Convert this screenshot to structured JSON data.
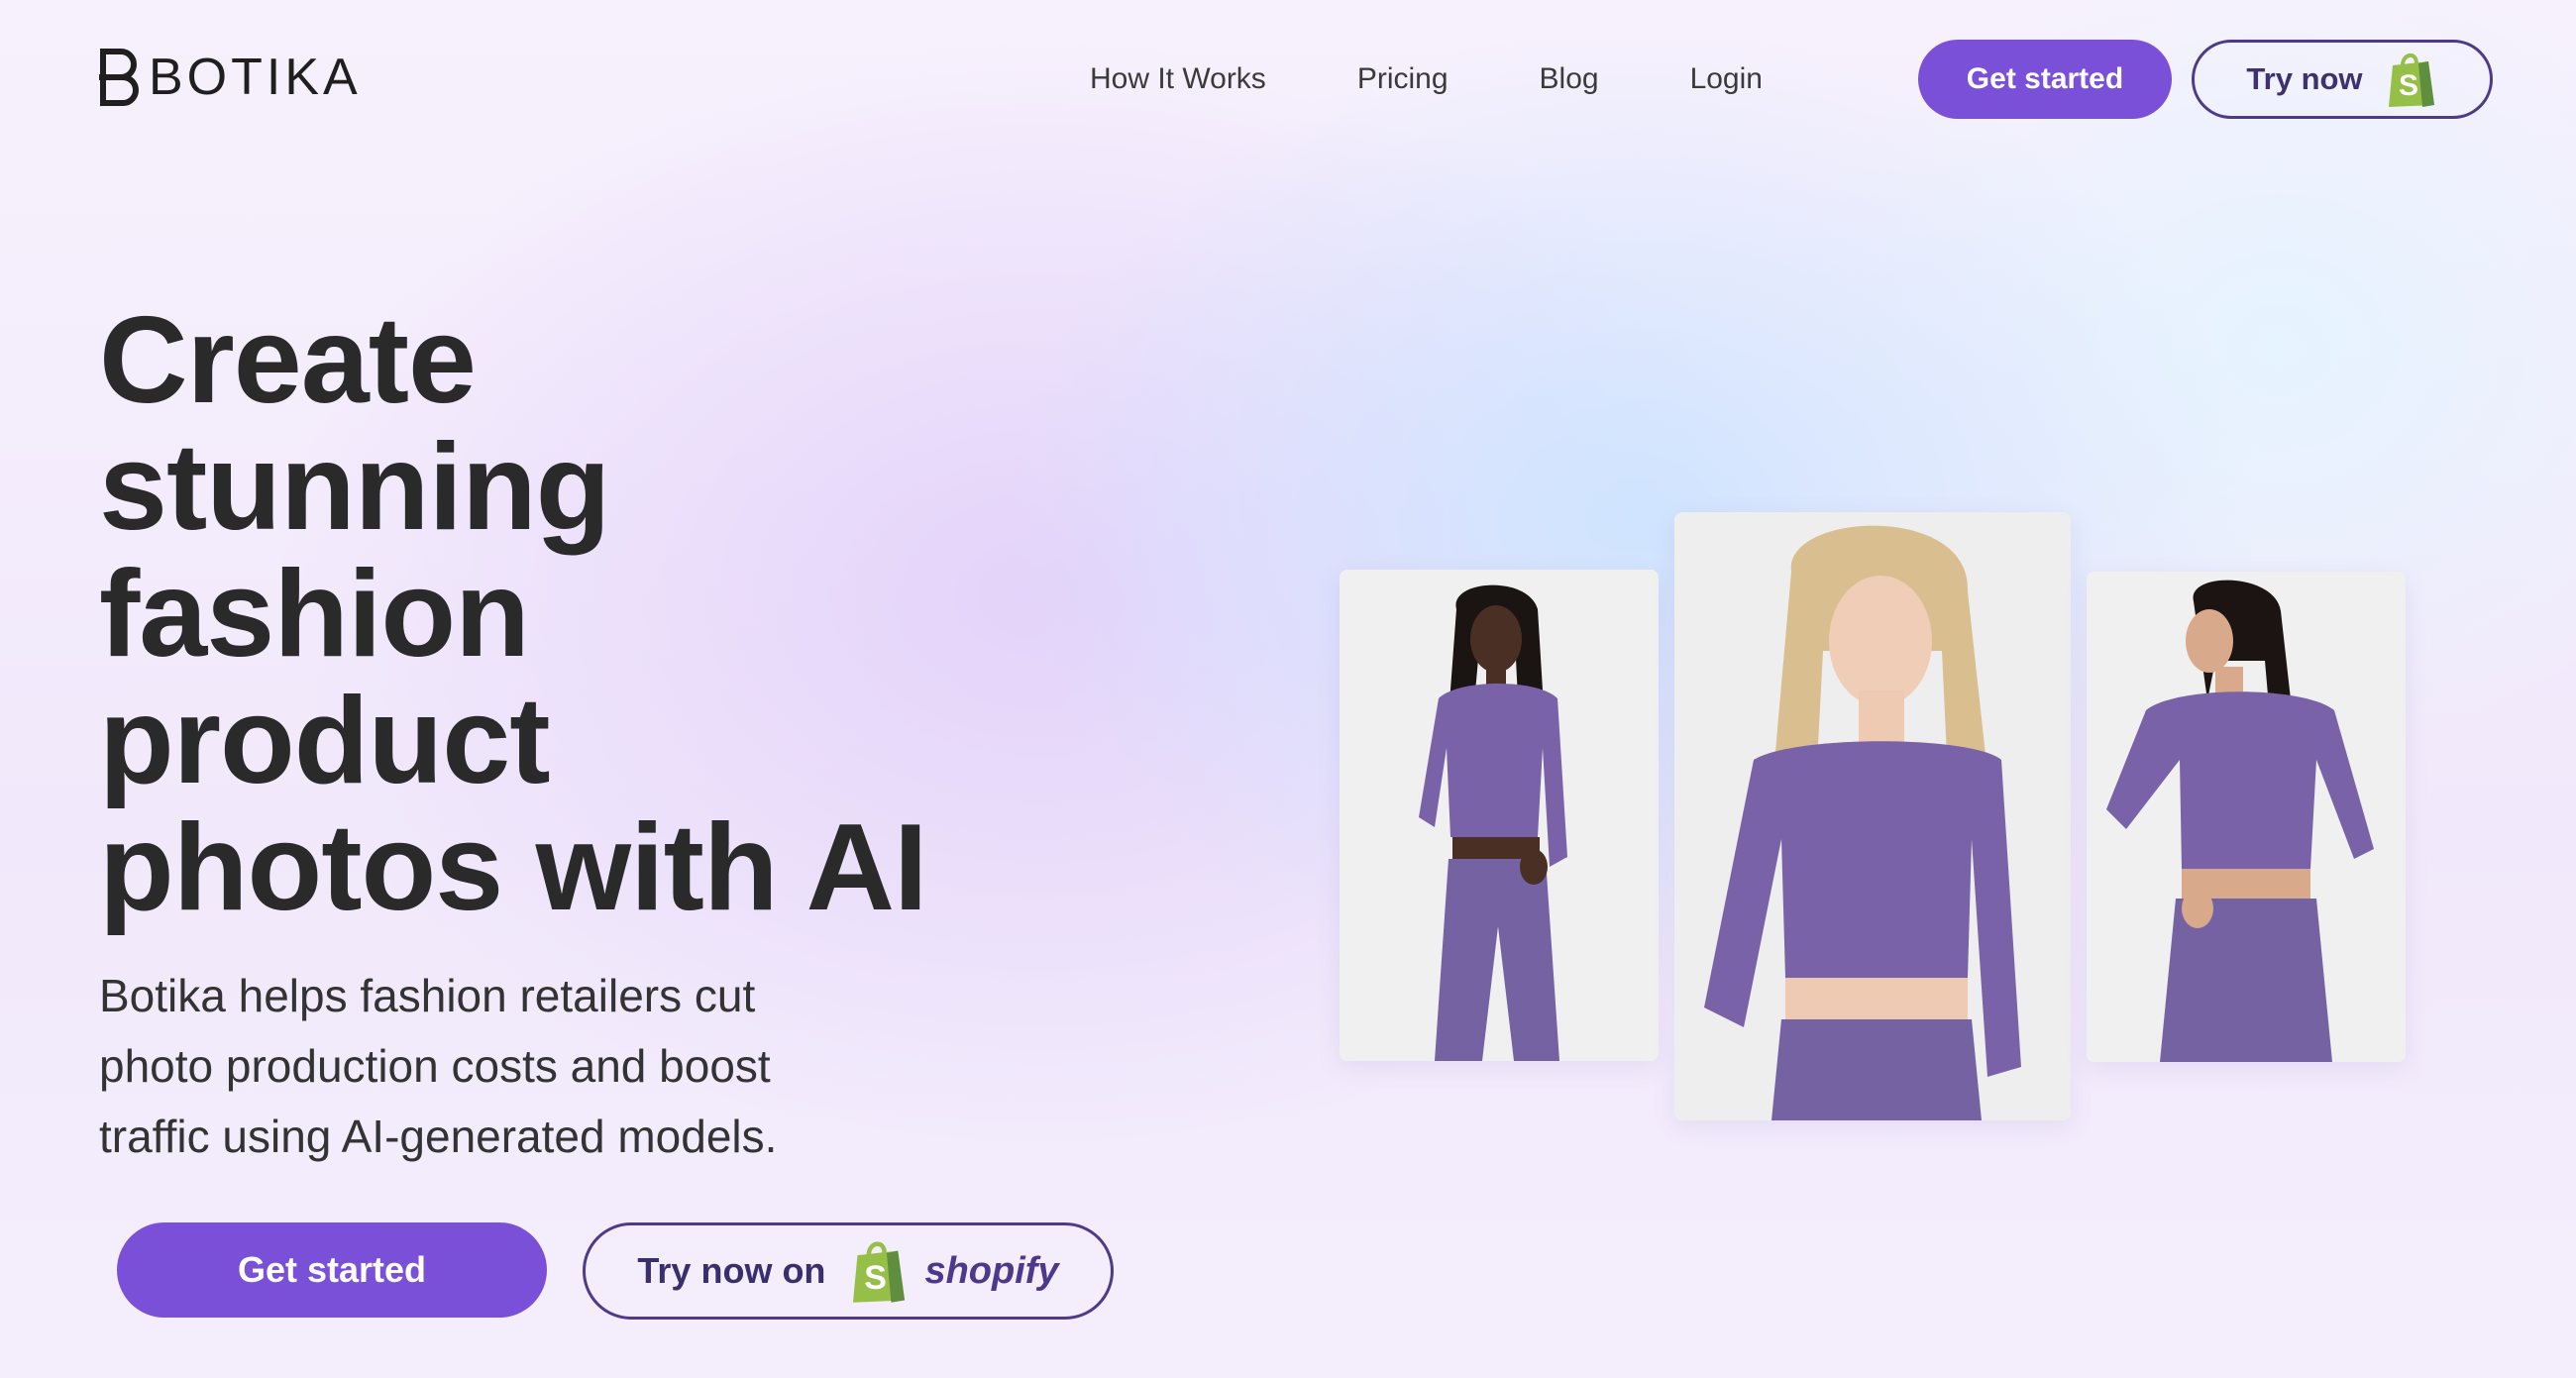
{
  "header": {
    "logo_text": "BOTIKA",
    "nav": {
      "how_it_works": "How It Works",
      "pricing": "Pricing",
      "blog": "Blog",
      "login": "Login"
    },
    "get_started": "Get started",
    "try_now": "Try now"
  },
  "hero": {
    "headline_lines": [
      "Create",
      "stunning",
      "fashion",
      "product",
      "photos with AI"
    ],
    "subtext_lines": [
      "Botika helps fashion retailers cut",
      "photo production costs and boost",
      "traffic using AI-generated models."
    ],
    "cta_get_started": "Get started",
    "cta_try_now_on": "Try now on",
    "cta_shopify": "shopify"
  },
  "colors": {
    "accent": "#7b50d8",
    "outline": "#4d3a8a",
    "shopify_green": "#95bf47",
    "outfit_purple": "#7a62a8"
  },
  "icons": {
    "logo": "botika-logo-icon",
    "shopify_bag": "shopify-bag-icon"
  }
}
